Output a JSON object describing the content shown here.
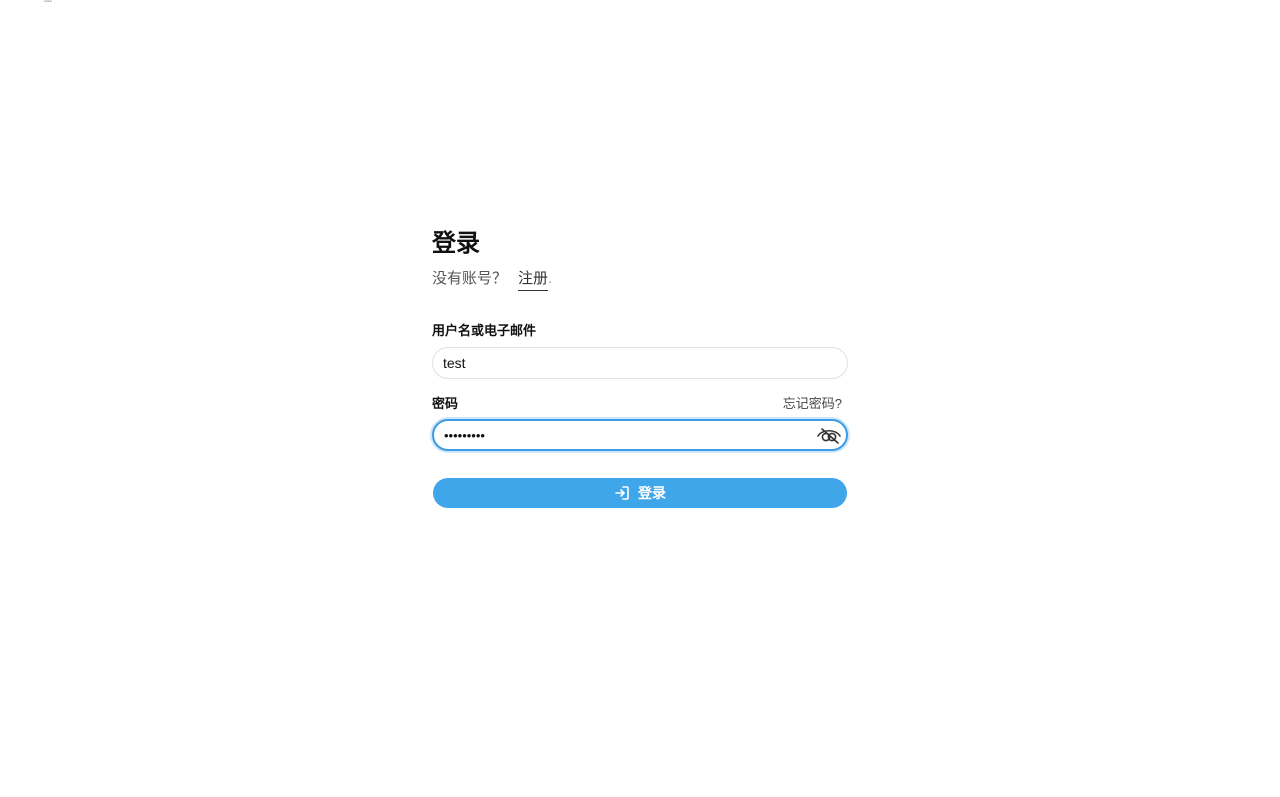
{
  "page": {
    "title": "登录",
    "corner_mark": "品"
  },
  "signup": {
    "prompt": "没有账号？",
    "link_label": "注册",
    "suffix": "."
  },
  "username": {
    "label": "用户名或电子邮件",
    "value": "test"
  },
  "password": {
    "label": "密码",
    "forgot_label": "忘记密码?",
    "masked_value": "•••••••••",
    "toggle_icon": "eye-slash-icon"
  },
  "submit": {
    "label": "登录",
    "icon": "sign-in-icon"
  },
  "colors": {
    "accent": "#3fa6ea",
    "focus_border": "#3a9be6",
    "focus_ring": "#cfe6f9",
    "input_border": "#e0e0e0"
  }
}
